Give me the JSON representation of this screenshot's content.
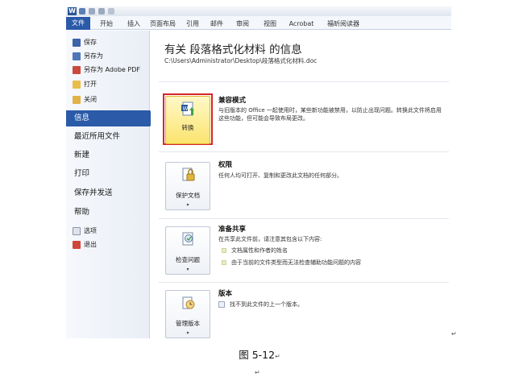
{
  "ribbon": {
    "tabs": [
      "文件",
      "开始",
      "插入",
      "页面布局",
      "引用",
      "邮件",
      "审阅",
      "视图",
      "Acrobat",
      "福昕阅读器"
    ]
  },
  "nav": {
    "commands": [
      "保存",
      "另存为",
      "另存为 Adobe PDF",
      "打开",
      "关闭"
    ],
    "sections": [
      "信息",
      "最近所用文件",
      "新建",
      "打印",
      "保存并发送",
      "帮助"
    ],
    "bottom_commands": [
      "选项",
      "退出"
    ],
    "active_section": "信息"
  },
  "info": {
    "title": "有关 段落格式化材料 的信息",
    "path": "C:\\Users\\Administrator\\Desktop\\段落格式化材料.doc"
  },
  "compat": {
    "button": "转换",
    "heading": "兼容模式",
    "text": "与旧版本的 Office 一起使用时，某些新功能被禁用，以防止出现问题。转换此文件将启用这些功能，但可能会导致布局更改。"
  },
  "perm": {
    "button": "保护文档",
    "heading": "权限",
    "text": "任何人均可打开、复制和更改此文档的任何部分。"
  },
  "share": {
    "button": "检查问题",
    "heading": "准备共享",
    "text": "在共享此文件前，请注意其包含以下内容:",
    "bullets": [
      "文档属性和作者的姓名",
      "由于当前的文件类型而无法检查辅助功能问题的内容"
    ]
  },
  "versions": {
    "button": "管理版本",
    "heading": "版本",
    "text": "找不到此文件的上一个版本。"
  },
  "caption": "图 5-12"
}
